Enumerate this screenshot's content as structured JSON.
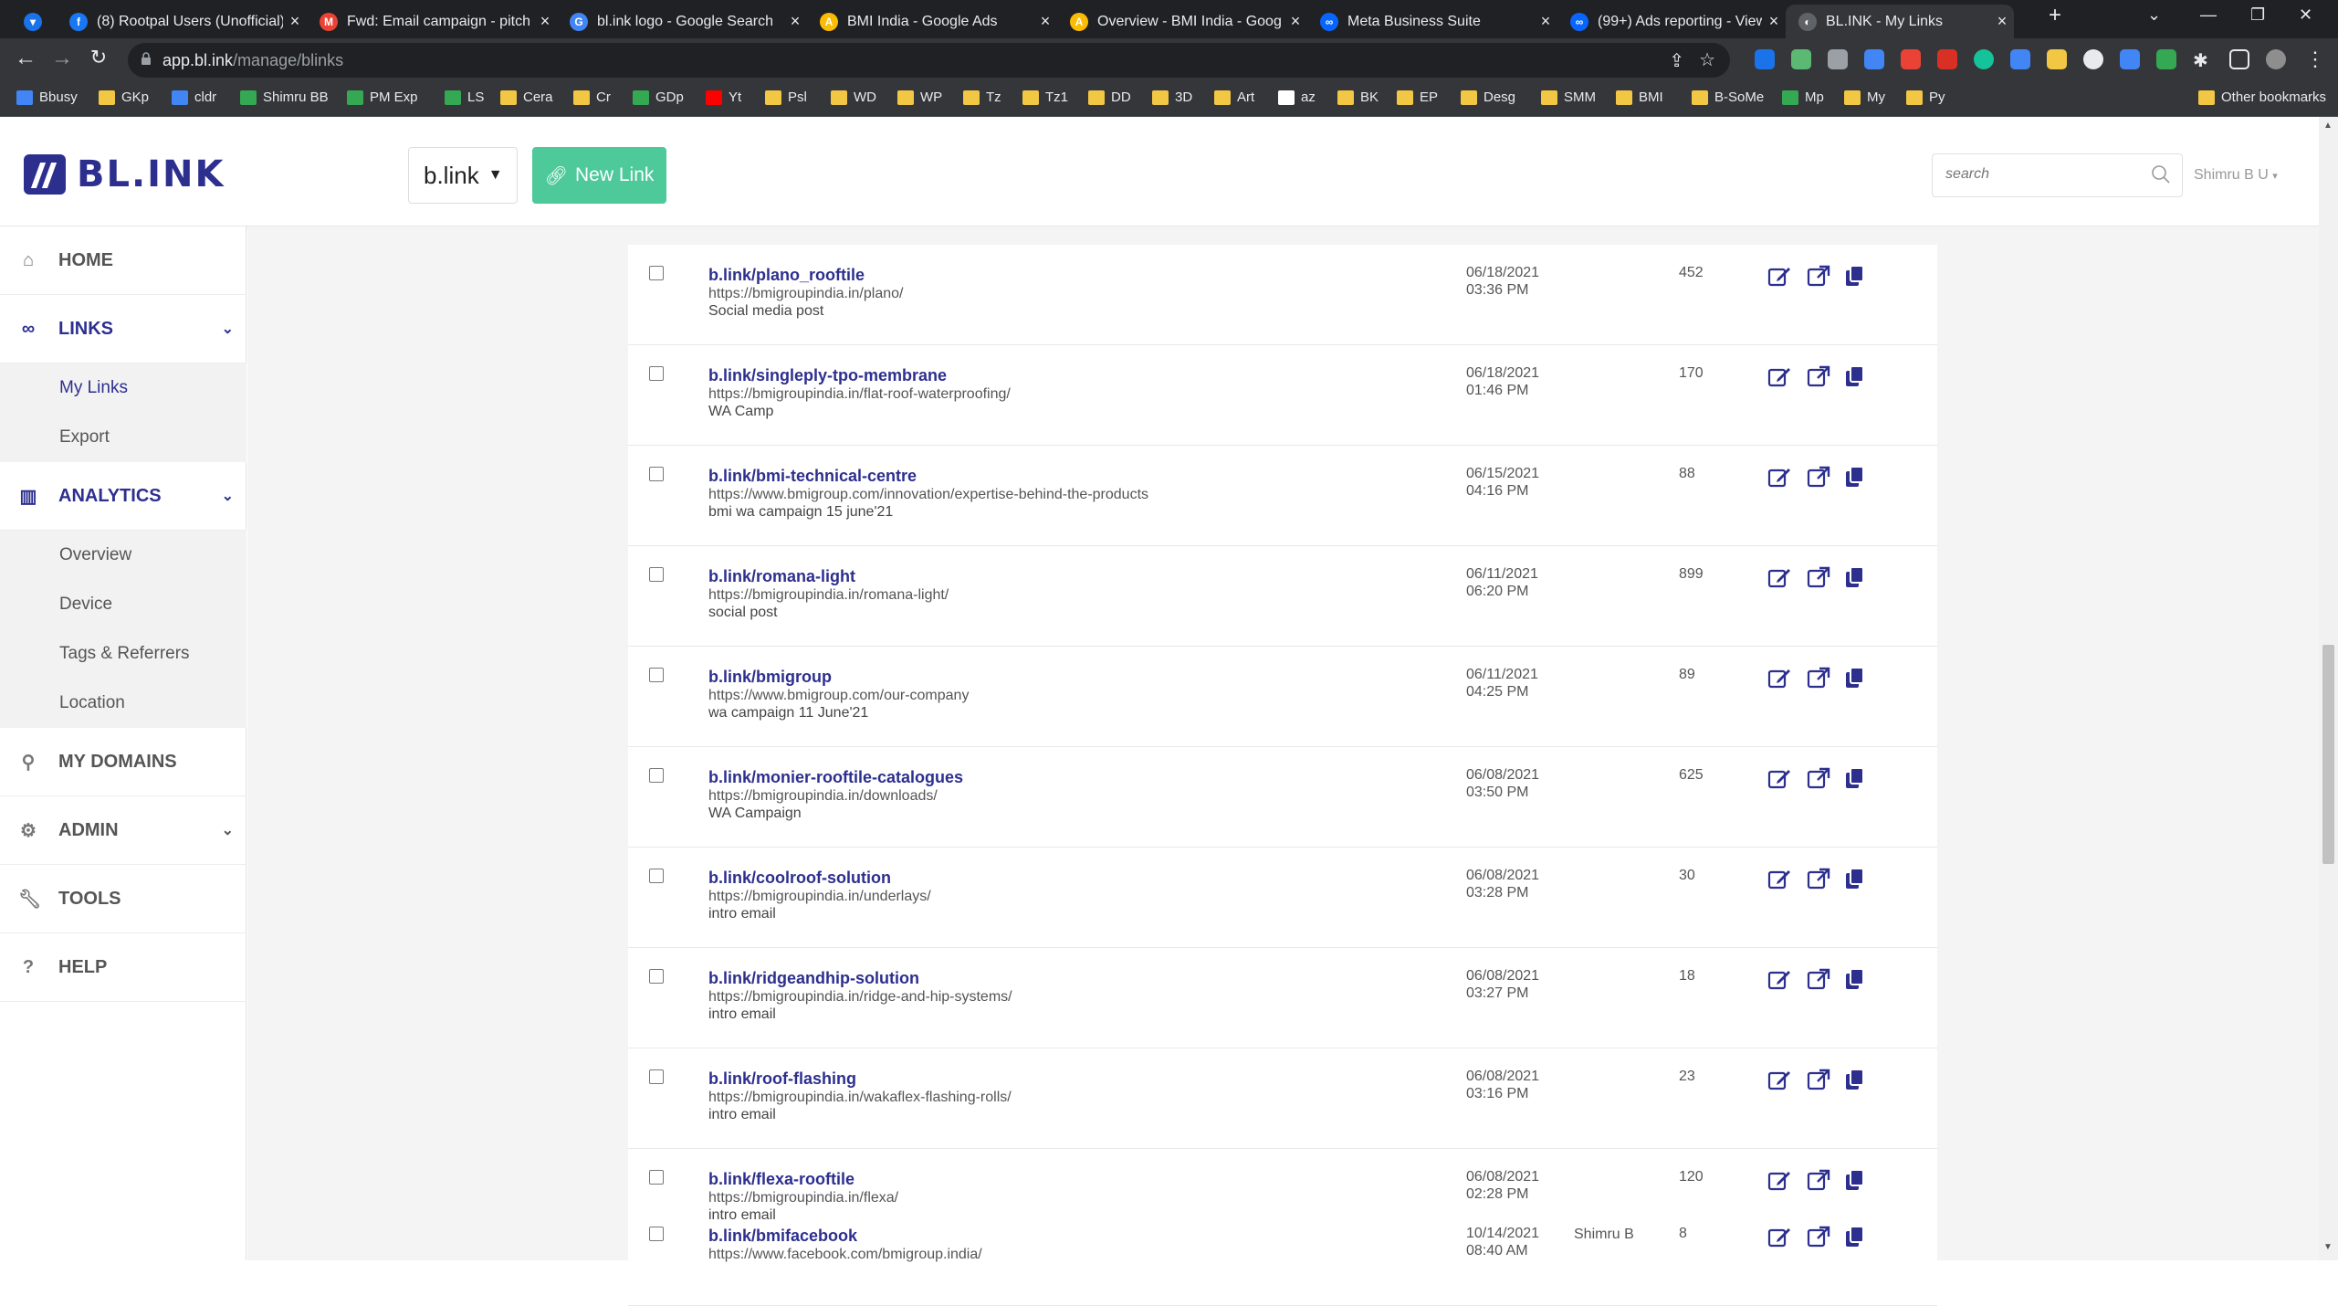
{
  "browser": {
    "tabs": [
      {
        "title": "",
        "color": "#1a73e8",
        "glyph": "▾"
      },
      {
        "title": "(8) Rootpal Users (Unofficial)",
        "color": "#1877f2",
        "glyph": "f"
      },
      {
        "title": "Fwd: Email campaign - pitch",
        "color": "#ea4335",
        "glyph": "M"
      },
      {
        "title": "bl.ink logo - Google Search",
        "color": "#4285f4",
        "glyph": "G"
      },
      {
        "title": "BMI India - Google Ads",
        "color": "#fbbc04",
        "glyph": "A"
      },
      {
        "title": "Overview - BMI India - Goog",
        "color": "#fbbc04",
        "glyph": "A"
      },
      {
        "title": "Meta Business Suite",
        "color": "#0866ff",
        "glyph": "∞"
      },
      {
        "title": "(99+) Ads reporting - View",
        "color": "#0866ff",
        "glyph": "∞"
      },
      {
        "title": "BL.INK - My Links",
        "color": "#5f6368",
        "glyph": "◐"
      }
    ],
    "new_tab": "+",
    "url_domain": "app.bl.ink",
    "url_path": "/manage/blinks",
    "bookmarks": [
      {
        "label": "Bbusy",
        "color": "#4285f4"
      },
      {
        "label": "GKp",
        "color": "#f2c744"
      },
      {
        "label": "cldr",
        "color": "#4285f4"
      },
      {
        "label": "Shimru BB",
        "color": "#34a853"
      },
      {
        "label": "PM Exp",
        "color": "#34a853"
      },
      {
        "label": "LS",
        "color": "#34a853"
      },
      {
        "label": "Cera",
        "color": "#f2c744"
      },
      {
        "label": "Cr",
        "color": "#f2c744"
      },
      {
        "label": "GDp",
        "color": "#34a853"
      },
      {
        "label": "Yt",
        "color": "#ff0000"
      },
      {
        "label": "Psl",
        "color": "#f2c744"
      },
      {
        "label": "WD",
        "color": "#f2c744"
      },
      {
        "label": "WP",
        "color": "#f2c744"
      },
      {
        "label": "Tz",
        "color": "#f2c744"
      },
      {
        "label": "Tz1",
        "color": "#f2c744"
      },
      {
        "label": "DD",
        "color": "#f2c744"
      },
      {
        "label": "3D",
        "color": "#f2c744"
      },
      {
        "label": "Art",
        "color": "#f2c744"
      },
      {
        "label": "az",
        "color": "#ffffff"
      },
      {
        "label": "BK",
        "color": "#f2c744"
      },
      {
        "label": "EP",
        "color": "#f2c744"
      },
      {
        "label": "Desg",
        "color": "#f2c744"
      },
      {
        "label": "SMM",
        "color": "#f2c744"
      },
      {
        "label": "BMI",
        "color": "#f2c744"
      },
      {
        "label": "B-SoMe",
        "color": "#f2c744"
      },
      {
        "label": "Mp",
        "color": "#34a853"
      },
      {
        "label": "My",
        "color": "#f2c744"
      },
      {
        "label": "Py",
        "color": "#f2c744"
      }
    ],
    "other_bookmarks": "Other bookmarks"
  },
  "app": {
    "logo_text": "BL.INK",
    "domain_select": "b.link",
    "new_link_label": "New Link",
    "search_placeholder": "search",
    "user_name": "Shimru B U"
  },
  "sidebar": {
    "home": "HOME",
    "links": "LINKS",
    "links_sub": [
      "My Links",
      "Export"
    ],
    "analytics": "ANALYTICS",
    "analytics_sub": [
      "Overview",
      "Device",
      "Tags & Referrers",
      "Location"
    ],
    "my_domains": "MY DOMAINS",
    "admin": "ADMIN",
    "tools": "TOOLS",
    "help": "HELP"
  },
  "links": [
    {
      "short": "b.link/plano_rooftile",
      "long": "https://bmigroupindia.in/plano/",
      "note": "Social media post",
      "date": "06/18/2021",
      "time": "03:36 PM",
      "owner": "",
      "clicks": "452"
    },
    {
      "short": "b.link/singleply-tpo-membrane",
      "long": "https://bmigroupindia.in/flat-roof-waterproofing/",
      "note": "WA Camp",
      "date": "06/18/2021",
      "time": "01:46 PM",
      "owner": "",
      "clicks": "170"
    },
    {
      "short": "b.link/bmi-technical-centre",
      "long": "https://www.bmigroup.com/innovation/expertise-behind-the-products",
      "note": "bmi wa campaign 15 june'21",
      "date": "06/15/2021",
      "time": "04:16 PM",
      "owner": "",
      "clicks": "88"
    },
    {
      "short": "b.link/romana-light",
      "long": "https://bmigroupindia.in/romana-light/",
      "note": "social post",
      "date": "06/11/2021",
      "time": "06:20 PM",
      "owner": "",
      "clicks": "899"
    },
    {
      "short": "b.link/bmigroup",
      "long": "https://www.bmigroup.com/our-company",
      "note": "wa campaign 11 June'21",
      "date": "06/11/2021",
      "time": "04:25 PM",
      "owner": "",
      "clicks": "89"
    },
    {
      "short": "b.link/monier-rooftile-catalogues",
      "long": "https://bmigroupindia.in/downloads/",
      "note": "WA Campaign",
      "date": "06/08/2021",
      "time": "03:50 PM",
      "owner": "",
      "clicks": "625"
    },
    {
      "short": "b.link/coolroof-solution",
      "long": "https://bmigroupindia.in/underlays/",
      "note": "intro email",
      "date": "06/08/2021",
      "time": "03:28 PM",
      "owner": "",
      "clicks": "30"
    },
    {
      "short": "b.link/ridgeandhip-solution",
      "long": "https://bmigroupindia.in/ridge-and-hip-systems/",
      "note": "intro email",
      "date": "06/08/2021",
      "time": "03:27 PM",
      "owner": "",
      "clicks": "18"
    },
    {
      "short": "b.link/roof-flashing",
      "long": "https://bmigroupindia.in/wakaflex-flashing-rolls/",
      "note": "intro email",
      "date": "06/08/2021",
      "time": "03:16 PM",
      "owner": "",
      "clicks": "23"
    },
    {
      "short": "b.link/flexa-rooftile",
      "long": "https://bmigroupindia.in/flexa/",
      "note": "intro email",
      "date": "06/08/2021",
      "time": "02:28 PM",
      "owner": "",
      "clicks": "120"
    },
    {
      "short": "b.link/bmifacebook",
      "long": "https://www.facebook.com/bmigroup.india/",
      "note": "",
      "date": "10/14/2021",
      "time": "08:40 AM",
      "owner": "Shimru B",
      "clicks": "8"
    }
  ],
  "colors": {
    "brand": "#2d2f8f",
    "accent": "#4dc99a"
  }
}
